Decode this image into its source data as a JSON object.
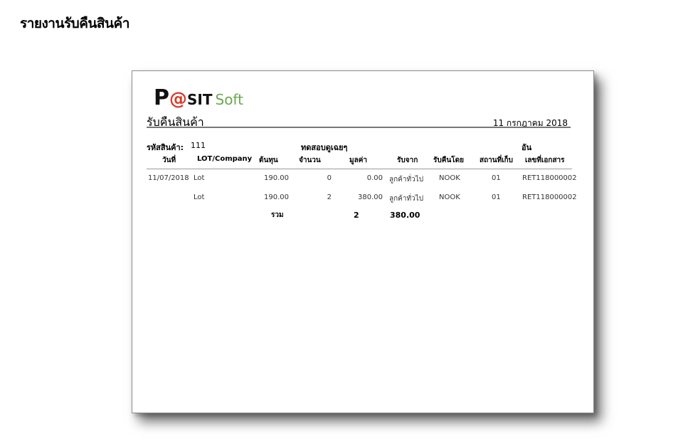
{
  "page_heading": "รายงานรับคืนสินค้า",
  "logo": {
    "p": "P",
    "at": "@",
    "sit": "SIT",
    "soft": "Soft"
  },
  "report": {
    "title": "รับคืนสินค้า",
    "date": "11 กรกฎาคม 2018",
    "product_code_label": "รหัสสินค้า:",
    "product_code": "111",
    "product_name": "ทดสอบดูเฉยๆ",
    "unit": "อัน"
  },
  "columns": [
    "วันที่",
    "LOT/Company",
    "ต้นทุน",
    "จำนวน",
    "มูลค่า",
    "รับจาก",
    "รับคืนโดย",
    "สถานที่เก็บ",
    "เลขที่เอกสาร"
  ],
  "rows": [
    {
      "date": "11/07/2018",
      "lot": "Lot",
      "cost": "190.00",
      "qty": "0",
      "value": "0.00",
      "from": "ลูกค้าทั่วไป",
      "by": "NOOK",
      "location": "01",
      "doc": "RET118000002"
    },
    {
      "date": "",
      "lot": "Lot",
      "cost": "190.00",
      "qty": "2",
      "value": "380.00",
      "from": "ลูกค้าทั่วไป",
      "by": "NOOK",
      "location": "01",
      "doc": "RET118000002"
    }
  ],
  "total": {
    "label": "รวม",
    "qty": "2",
    "value": "380.00"
  }
}
